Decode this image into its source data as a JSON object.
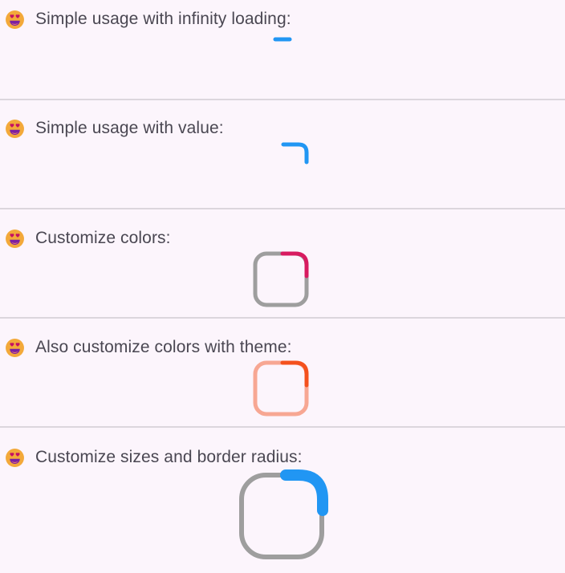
{
  "sections": [
    {
      "label": "Simple usage with infinity loading:",
      "icon": "smiling-face-with-heart-eyes-icon",
      "progress": null,
      "accent_color": "#2196f3"
    },
    {
      "label": "Simple usage with value:",
      "icon": "smiling-face-with-heart-eyes-icon",
      "progress": 0.1,
      "accent_color": "#2196f3"
    },
    {
      "label": "Customize colors:",
      "icon": "smiling-face-with-heart-eyes-icon",
      "progress": 0.15,
      "accent_color": "#d81b60",
      "track_color": "#9e9e9e"
    },
    {
      "label": "Also customize colors with theme:",
      "icon": "smiling-face-with-heart-eyes-icon",
      "progress": 0.15,
      "accent_color": "#f4511e",
      "track_color": "#f7a793"
    },
    {
      "label": "Customize sizes and border radius:",
      "icon": "smiling-face-with-heart-eyes-icon",
      "progress": 0.2,
      "accent_color": "#2196f3",
      "track_color": "#9e9e9e"
    }
  ]
}
